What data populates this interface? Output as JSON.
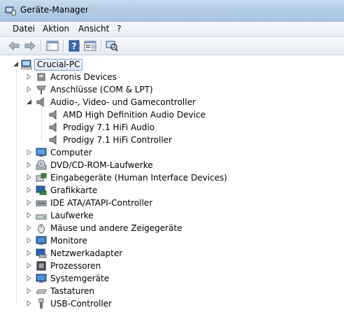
{
  "window": {
    "title": "Geräte-Manager",
    "subtitle": "User den Computer anzeigen"
  },
  "menu": [
    "Datei",
    "Aktion",
    "Ansicht",
    "?"
  ],
  "toolbar": {
    "buttons": [
      "back-arrow-icon",
      "forward-arrow-icon",
      "show-hide-console-tree-icon",
      "help-icon",
      "properties-icon",
      "scan-hardware-icon"
    ]
  },
  "tree": {
    "root": "Crucial-PC",
    "categories": [
      {
        "label": "Acronis Devices",
        "icon": "acronis-device-icon",
        "expanded": false
      },
      {
        "label": "Anschlüsse (COM & LPT)",
        "icon": "port-icon",
        "expanded": false
      },
      {
        "label": "Audio-, Video- und Gamecontroller",
        "icon": "speaker-icon",
        "expanded": true,
        "children": [
          "AMD High Definition Audio Device",
          "Prodigy 7.1 HiFi Audio",
          "Prodigy 7.1 HiFi Controller"
        ]
      },
      {
        "label": "Computer",
        "icon": "computer-icon",
        "expanded": false
      },
      {
        "label": "DVD/CD-ROM-Laufwerke",
        "icon": "optical-drive-icon",
        "expanded": false
      },
      {
        "label": "Eingabegeräte (Human Interface Devices)",
        "icon": "hid-icon",
        "expanded": false
      },
      {
        "label": "Grafikkarte",
        "icon": "display-adapter-icon",
        "expanded": false
      },
      {
        "label": "IDE ATA/ATAPI-Controller",
        "icon": "ide-controller-icon",
        "expanded": false
      },
      {
        "label": "Laufwerke",
        "icon": "disk-drive-icon",
        "expanded": false
      },
      {
        "label": "Mäuse und andere Zeigegeräte",
        "icon": "mouse-icon",
        "expanded": false
      },
      {
        "label": "Monitore",
        "icon": "monitor-icon",
        "expanded": false
      },
      {
        "label": "Netzwerkadapter",
        "icon": "network-adapter-icon",
        "expanded": false
      },
      {
        "label": "Prozessoren",
        "icon": "processor-icon",
        "expanded": false
      },
      {
        "label": "Systemgeräte",
        "icon": "system-device-icon",
        "expanded": false
      },
      {
        "label": "Tastaturen",
        "icon": "keyboard-icon",
        "expanded": false
      },
      {
        "label": "USB-Controller",
        "icon": "usb-icon",
        "expanded": false
      }
    ]
  },
  "colors": {
    "titlebar": "#b3cbe6",
    "selection_border": "#7da2ce"
  }
}
